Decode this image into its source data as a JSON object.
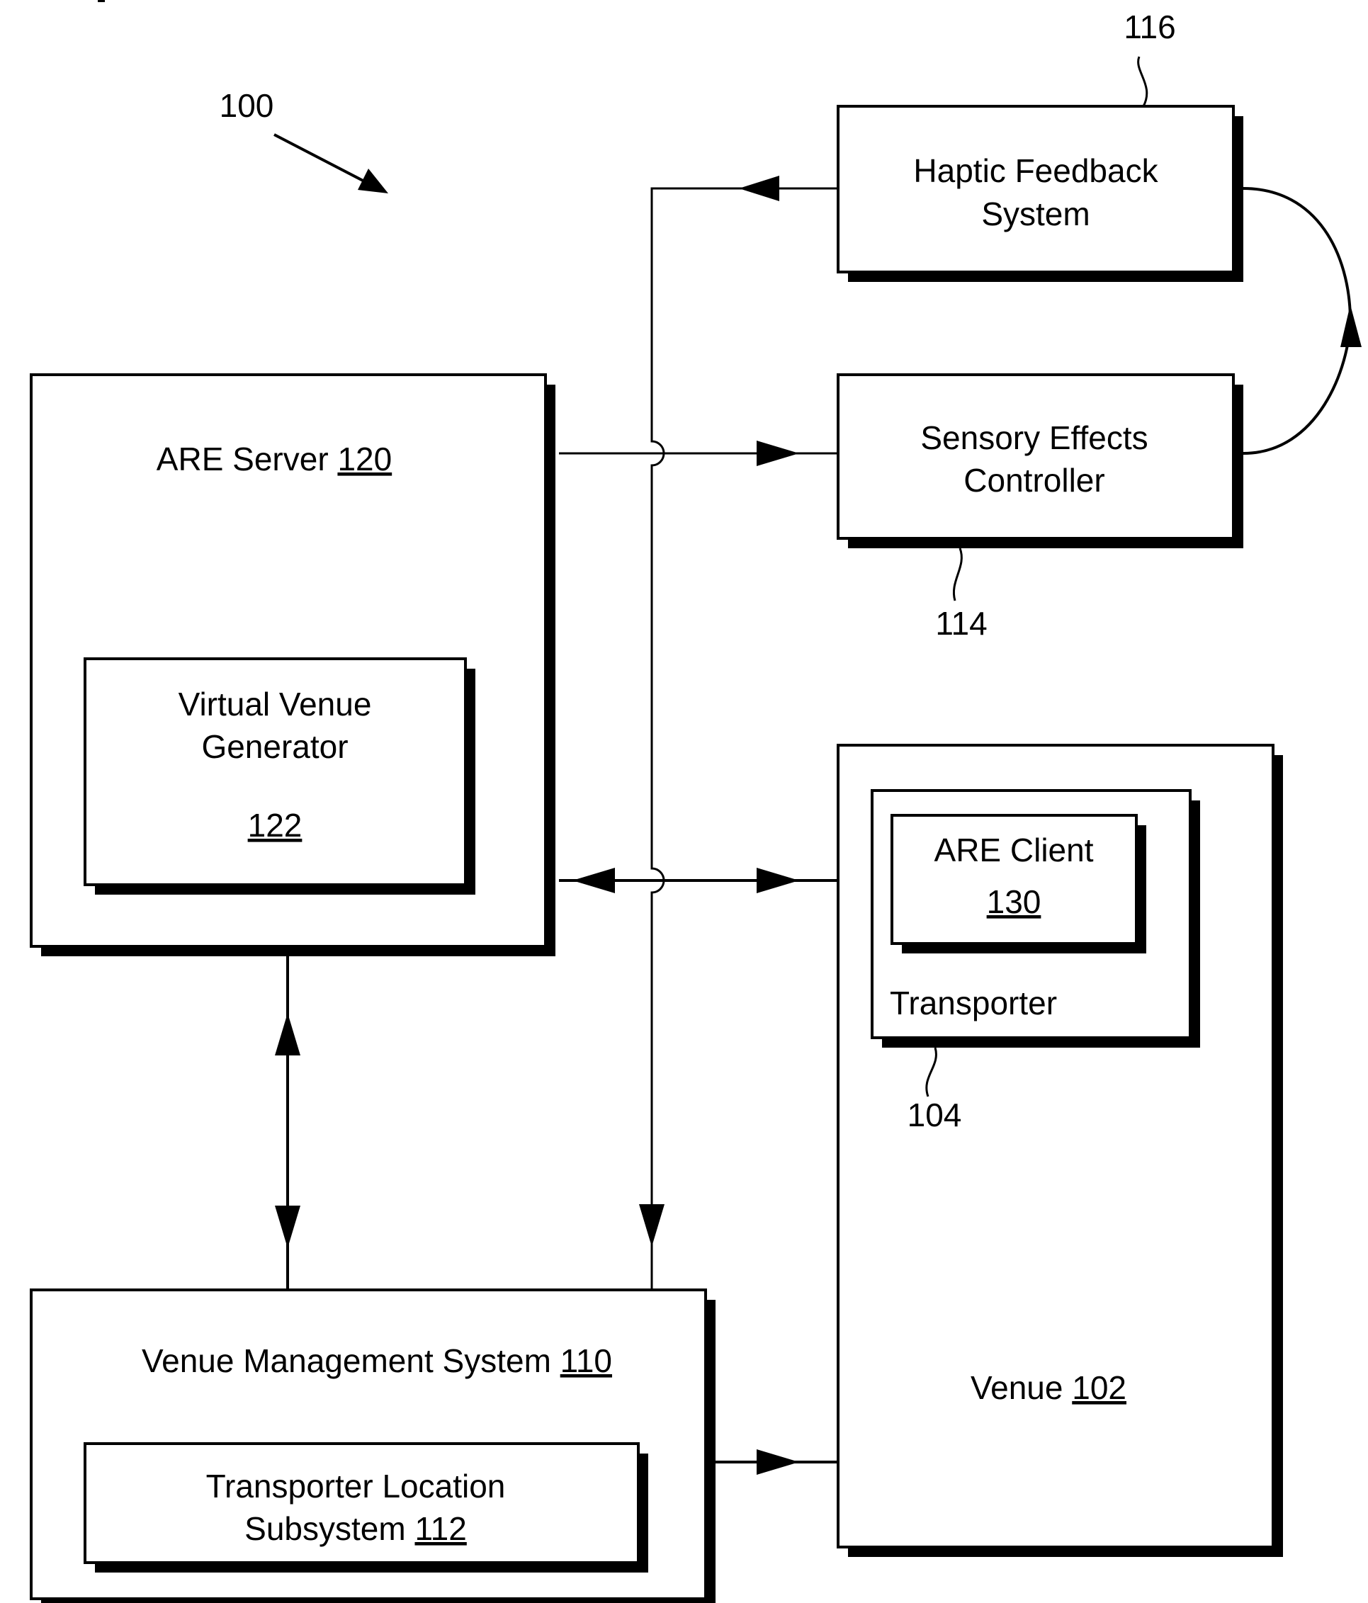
{
  "figure": {
    "label": "100",
    "stub_text": "_"
  },
  "components": {
    "haptic": {
      "line1": "Haptic Feedback",
      "line2": "System",
      "callout": "116"
    },
    "sensory": {
      "line1": "Sensory Effects",
      "line2": "Controller",
      "callout": "114"
    },
    "are_server": {
      "name": "ARE Server ",
      "ref": "120"
    },
    "vvg": {
      "line1": "Virtual Venue",
      "line2": "Generator",
      "ref": "122"
    },
    "venue": {
      "name": "Venue ",
      "ref": "102"
    },
    "transporter": {
      "name": "Transporter",
      "callout": "104"
    },
    "are_client": {
      "name": "ARE Client",
      "ref": "130"
    },
    "vms": {
      "name": "Venue Management System ",
      "ref": "110"
    },
    "tls": {
      "line1": "Transporter Location",
      "line2": "Subsystem ",
      "ref": "112"
    }
  },
  "connections": [
    {
      "from": "Haptic Feedback System",
      "to": "Venue Management System",
      "direction": "one-way"
    },
    {
      "from": "ARE Server",
      "to": "Sensory Effects Controller",
      "direction": "one-way"
    },
    {
      "from": "Sensory Effects Controller",
      "to": "Haptic Feedback System",
      "direction": "one-way"
    },
    {
      "from": "ARE Server",
      "to": "ARE Client",
      "direction": "two-way"
    },
    {
      "from": "ARE Server",
      "to": "Venue Management System",
      "direction": "two-way"
    },
    {
      "from": "Venue Management System",
      "to": "Venue",
      "direction": "one-way"
    }
  ]
}
